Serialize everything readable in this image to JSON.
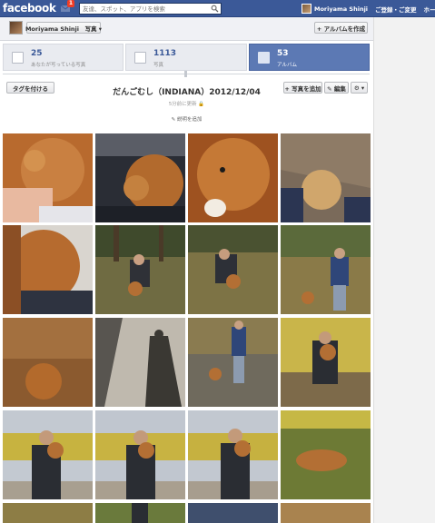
{
  "topbar": {
    "logo": "facebook",
    "notifications": "1",
    "search_placeholder": "友達、スポット、アプリを検索",
    "user_name": "Moriyama Shinji",
    "find_friends": "ご登録・ご変更",
    "home": "ホーム"
  },
  "header": {
    "profile_button": "Moriyama Shinji　写真 ▾",
    "create_album": "+ アルバムを作成"
  },
  "tiles": [
    {
      "count": "25",
      "label": "あなたが写っている写真"
    },
    {
      "count": "1113",
      "label": "写真"
    },
    {
      "count": "53",
      "label": "アルバム"
    }
  ],
  "album": {
    "tag_button": "タグを付ける",
    "add_photos": "+ 写真を追加",
    "edit": "✎ 編集",
    "settings": "⚙ ▾",
    "title": "だんごむし（INDIANA）2012/12/04",
    "updated": "5分前に更新 🔒",
    "add_description": "✎ 説明を追加"
  },
  "photos": [
    {
      "name": "photo-1",
      "desc": "dog close-up with hand"
    },
    {
      "name": "photo-2",
      "desc": "dog lying in lap"
    },
    {
      "name": "photo-3",
      "desc": "dog face close-up"
    },
    {
      "name": "photo-4",
      "desc": "dog on path"
    },
    {
      "name": "photo-5",
      "desc": "dog side close-up"
    },
    {
      "name": "photo-6",
      "desc": "man crouching with dog"
    },
    {
      "name": "photo-7",
      "desc": "man crouching with dog 2"
    },
    {
      "name": "photo-8",
      "desc": "boy walking dog"
    },
    {
      "name": "photo-9",
      "desc": "dog in leaves"
    },
    {
      "name": "photo-10",
      "desc": "shadow on path"
    },
    {
      "name": "photo-11",
      "desc": "boy and dog on path"
    },
    {
      "name": "photo-12",
      "desc": "man holding dog under ginkgo"
    },
    {
      "name": "photo-13",
      "desc": "man holding dog under tree"
    },
    {
      "name": "photo-14",
      "desc": "man holding dog 2"
    },
    {
      "name": "photo-15",
      "desc": "man holding dog 3"
    },
    {
      "name": "photo-16",
      "desc": "dog on grass"
    }
  ]
}
